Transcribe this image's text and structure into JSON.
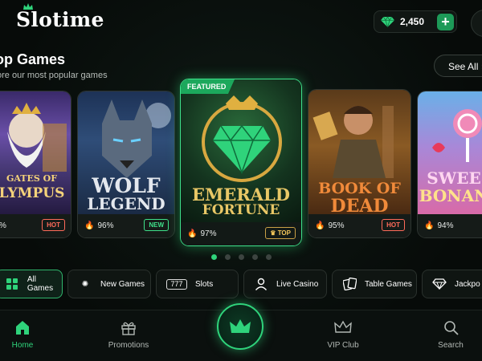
{
  "app": {
    "name": "Slotime"
  },
  "header": {
    "balance": "2,450",
    "add_label": "+"
  },
  "section": {
    "title": "op Games",
    "subtitle": "ore our most popular games",
    "see_all": "See All"
  },
  "games": [
    {
      "title_lines": [
        "GATES OF",
        "LYMPUS"
      ],
      "pct": "%",
      "badge": "HOT"
    },
    {
      "title_lines": [
        "WOLF",
        "LEGEND"
      ],
      "pct": "96%",
      "badge": "NEW"
    },
    {
      "title_lines": [
        "EMERALD",
        "FORTUNE"
      ],
      "pct": "97%",
      "badge": "TOP",
      "featured": "FEATURED"
    },
    {
      "title_lines": [
        "BOOK OF",
        "DEAD"
      ],
      "pct": "95%",
      "badge": "HOT"
    },
    {
      "title_lines": [
        "SWEE",
        "BONAN"
      ],
      "pct": "94%",
      "badge": ""
    }
  ],
  "carousel": {
    "pages": 5,
    "active": 0
  },
  "categories": [
    {
      "label": "All Games",
      "icon": "grid-icon"
    },
    {
      "label": "New Games",
      "icon": "sparkle-icon"
    },
    {
      "label": "Slots",
      "icon": "slots-777-icon"
    },
    {
      "label": "Live Casino",
      "icon": "person-icon"
    },
    {
      "label": "Table Games",
      "icon": "cards-icon"
    },
    {
      "label": "Jackpo",
      "icon": "diamond-icon"
    }
  ],
  "nav": {
    "home": "Home",
    "promotions": "Promotions",
    "vip": "VIP Club",
    "search": "Search"
  },
  "colors": {
    "accent": "#2fd37b",
    "hot": "#ff6b5a",
    "top": "#f3c65a"
  }
}
